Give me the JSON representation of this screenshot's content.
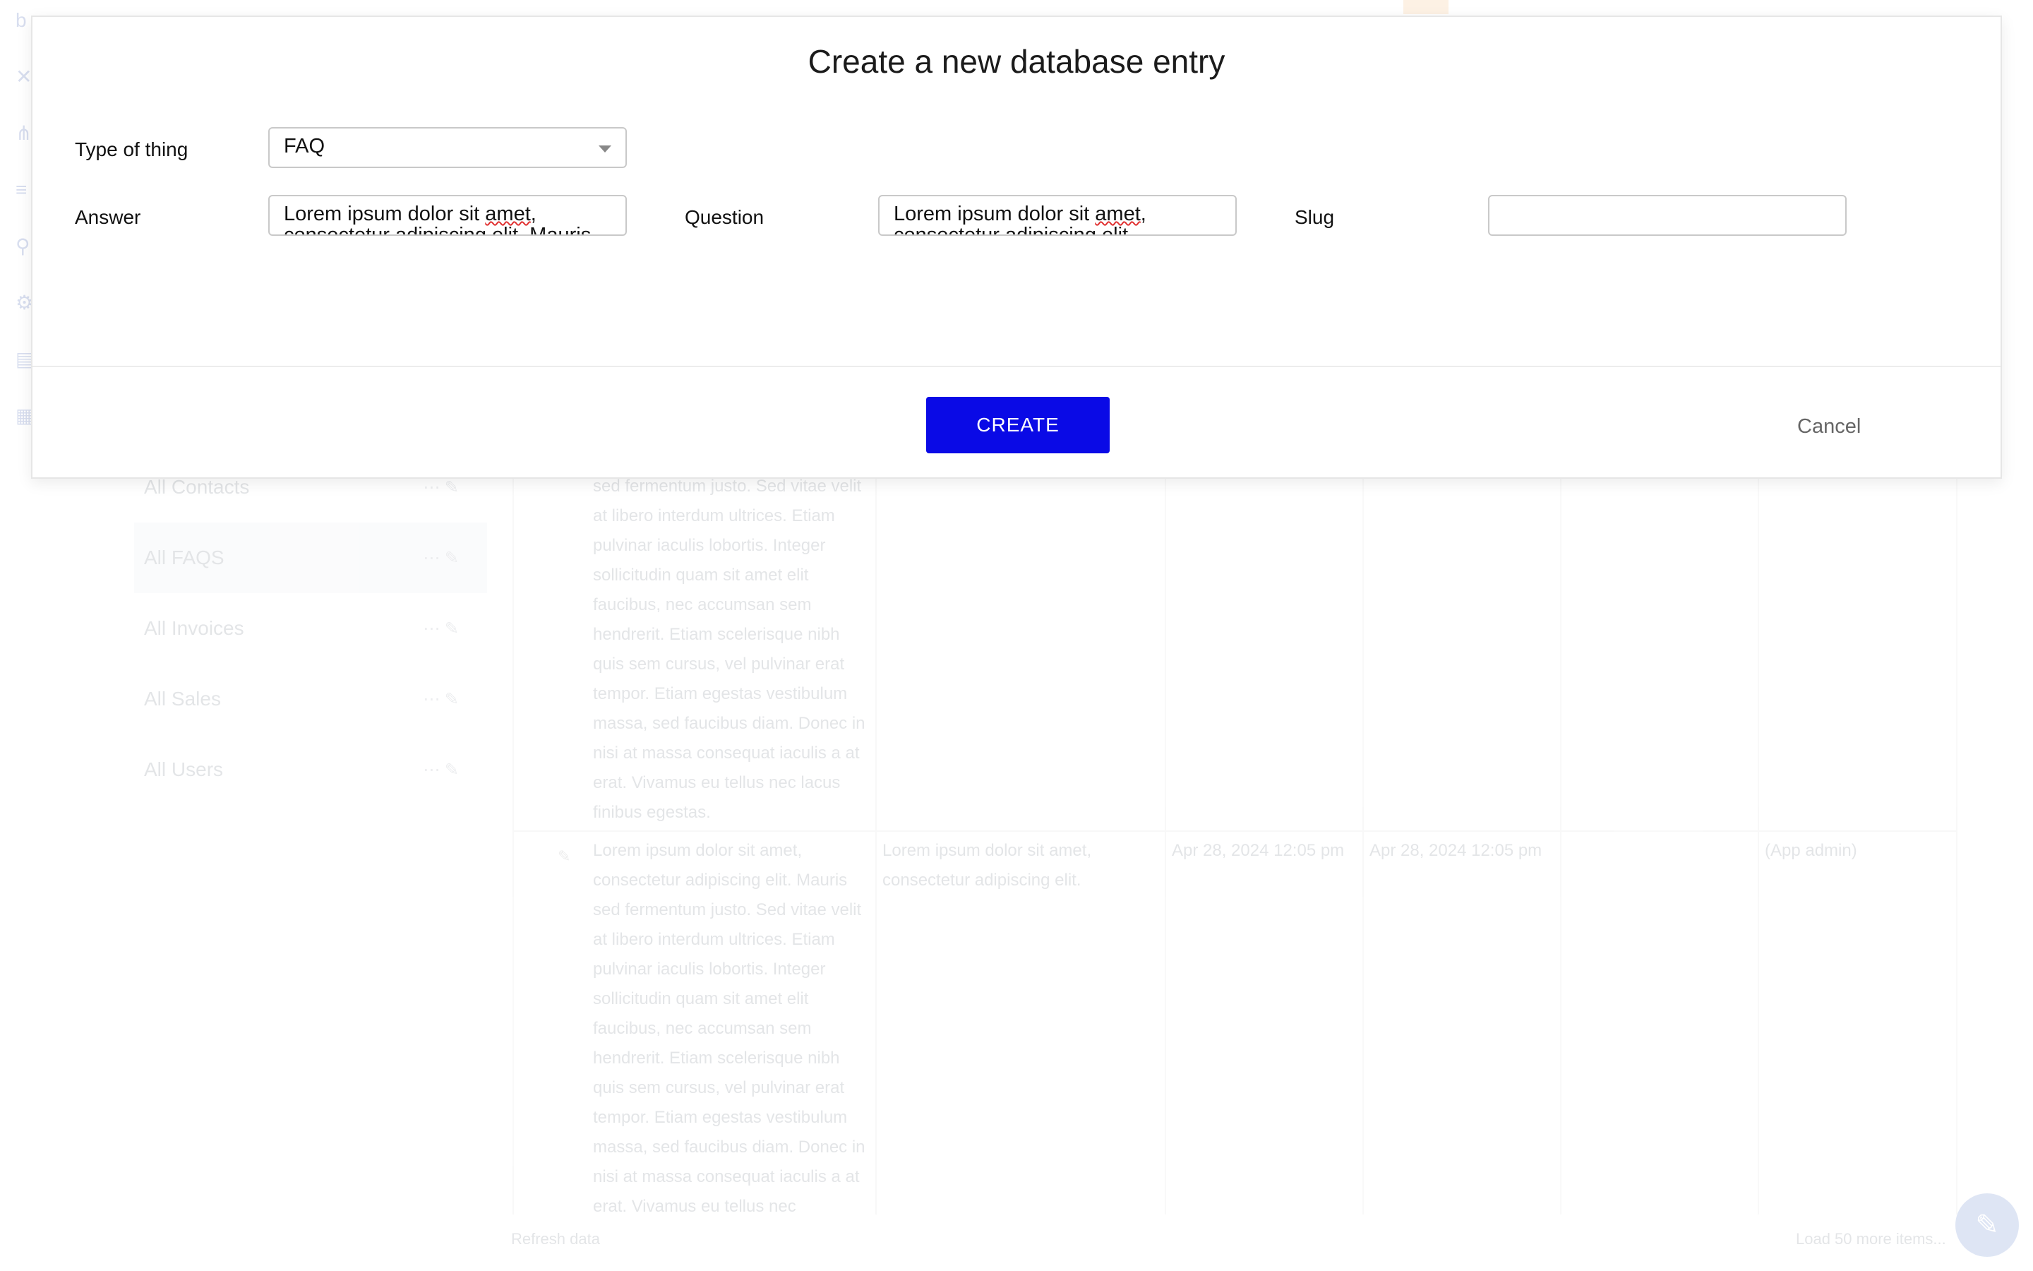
{
  "modal": {
    "title": "Create a new database entry",
    "fields": {
      "type_label": "Type of thing",
      "type_value": "FAQ",
      "answer_label": "Answer",
      "answer_value_line1": "Lorem ipsum dolor sit ",
      "answer_value_line1_spell": "amet",
      "answer_value_line2": "consectetur adipiscing elit. Mauris",
      "question_label": "Question",
      "question_value_line1": "Lorem ipsum dolor sit ",
      "question_value_line1_spell": "amet",
      "question_value_line2": "consectetur adipiscing elit.",
      "slug_label": "Slug",
      "slug_value": ""
    },
    "create_label": "CREATE",
    "cancel_label": "Cancel",
    "accent_color": "#0a0ae6"
  },
  "background": {
    "sidebar": {
      "items": [
        {
          "label": "All Contacts"
        },
        {
          "label": "All FAQS"
        },
        {
          "label": "All Invoices"
        },
        {
          "label": "All Sales"
        },
        {
          "label": "All Users"
        }
      ]
    },
    "row1": {
      "answer": "sed fermentum justo. Sed vitae velit at libero interdum ultrices. Etiam pulvinar iaculis lobortis. Integer sollicitudin quam sit amet elit faucibus, nec accumsan sem hendrerit. Etiam scelerisque nibh quis sem cursus, vel pulvinar erat tempor. Etiam egestas vestibulum massa, sed faucibus diam. Donec in nisi at massa consequat iaculis a at erat. Vivamus eu tellus nec lacus finibus egestas."
    },
    "row2": {
      "answer": "Lorem ipsum dolor sit amet, consectetur adipiscing elit. Mauris sed fermentum justo. Sed vitae velit at libero interdum ultrices. Etiam pulvinar iaculis lobortis. Integer sollicitudin quam sit amet elit faucibus, nec accumsan sem hendrerit. Etiam scelerisque nibh quis sem cursus, vel pulvinar erat tempor. Etiam egestas vestibulum massa, sed faucibus diam. Donec in nisi at massa consequat iaculis a at erat. Vivamus eu tellus nec",
      "question": "Lorem ipsum dolor sit amet, consectetur adipiscing elit.",
      "created": "Apr 28, 2024 12:05 pm",
      "modified": "Apr 28, 2024 12:05 pm",
      "creator": "(App admin)"
    },
    "footer": {
      "refresh_label": "Refresh data",
      "load_more_label": "Load 50 more items..."
    },
    "icons": [
      "bubble-logo-icon",
      "tools-icon",
      "hierarchy-icon",
      "database-icon",
      "plug-icon",
      "settings-icon",
      "logs-icon",
      "edit-icon",
      "help-icon"
    ]
  }
}
